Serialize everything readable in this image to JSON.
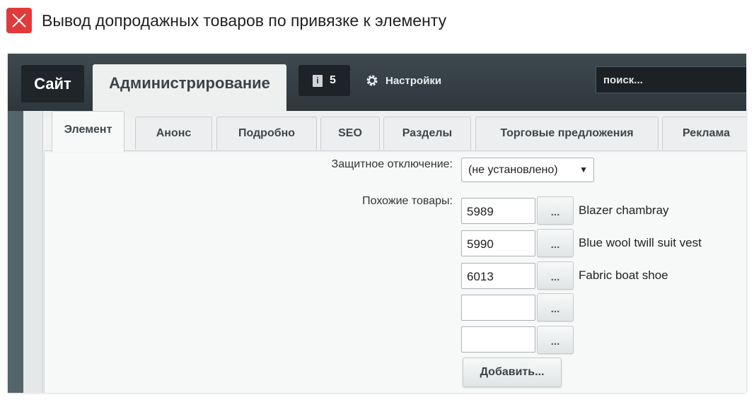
{
  "heading": {
    "icon": "close-icon",
    "icon_color": "#e23a3a",
    "text": "Вывод допродажных товаров по привязке к элементу"
  },
  "topbar": {
    "site_tab": "Сайт",
    "admin_tab": "Администрирование",
    "notification_count": "5",
    "settings_label": "Настройки",
    "search_placeholder": "поиск..."
  },
  "tabs": [
    {
      "label": "Элемент",
      "active": true
    },
    {
      "label": "Анонс",
      "active": false
    },
    {
      "label": "Подробно",
      "active": false
    },
    {
      "label": "SEO",
      "active": false
    },
    {
      "label": "Разделы",
      "active": false
    },
    {
      "label": "Торговые предложения",
      "active": false
    },
    {
      "label": "Реклама",
      "active": false
    }
  ],
  "form": {
    "protection_label": "Защитное отключение:",
    "protection_value": "(не установлено)",
    "similar_label": "Похожие товары:",
    "similar_items": [
      {
        "id": "5989",
        "name": "Blazer chambray"
      },
      {
        "id": "5990",
        "name": "Blue wool twill suit vest"
      },
      {
        "id": "6013",
        "name": "Fabric boat shoe"
      },
      {
        "id": "",
        "name": ""
      },
      {
        "id": "",
        "name": ""
      }
    ],
    "picker_label": "...",
    "add_button": "Добавить..."
  }
}
